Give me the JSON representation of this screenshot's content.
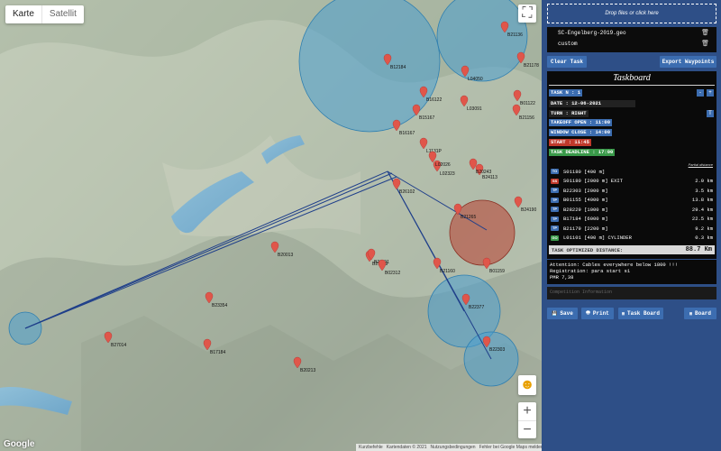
{
  "map": {
    "type_tabs": [
      "Karte",
      "Satellit"
    ],
    "fullscreen_glyph": "⛶",
    "zoom_in": "+",
    "zoom_out": "−",
    "pegman_glyph": "☻",
    "google_logo": "Google",
    "footer": [
      "Kurzbefehle",
      "Kartendaten © 2021",
      "Nutzungsbedingungen",
      "Fehler bei Google Maps melden"
    ],
    "waypoints": [
      "B16122",
      "B12184",
      "B16167",
      "B15167",
      "L1131P",
      "L02323",
      "B21136",
      "B21178",
      "L04050",
      "L03091",
      "B22303",
      "B23354",
      "B24113",
      "B20243",
      "B21265",
      "B22377",
      "B21229",
      "B20013",
      "B17184",
      "B20213",
      "B21191",
      "B02312",
      "B01159",
      "B01122",
      "B21156",
      "B26102",
      "B27014",
      "B24190",
      "L02026",
      "B21160"
    ],
    "colors": {
      "cylinder_blue": "#4a9fd0",
      "cylinder_red": "#b94a3a",
      "route": "#1f3f8a",
      "marker": "#e0564a"
    }
  },
  "panel": {
    "drop_text": "Drop files or click here",
    "files": [
      {
        "name": "SC-Engelberg-2019.geo",
        "delete_icon": "🗑"
      },
      {
        "name": "custom",
        "delete_icon": "🗑"
      }
    ],
    "clear_task": "Clear Task",
    "export_waypoints": "Export Waypoints",
    "taskboard": {
      "title": "Taskboard",
      "task_n": "TASK N : 1",
      "date": "DATE : 12-06-2021",
      "turn": "TURN : RIGHT",
      "takeoff": "TAKEOFF OPEN : 11:00",
      "window_close": "WINDOW CLOSE : 14:00",
      "start": "START : 11:45",
      "deadline": "TASK DEADLINE : 17:00",
      "partial_label": "Partial distance",
      "btn_minus": "-",
      "btn_plus": "+",
      "btn_t": "T",
      "turnpoints": [
        {
          "type": "TO",
          "color": "#3c6db0",
          "name": "S01180 [400 m]",
          "dist": ""
        },
        {
          "type": "SS",
          "color": "#c0392b",
          "name": "S01180 [2000 m] EXIT",
          "dist": "2.0 km"
        },
        {
          "type": "TP",
          "color": "#3c6db0",
          "name": "B22303 [2000 m]",
          "dist": "3.5 km"
        },
        {
          "type": "TP",
          "color": "#3c6db0",
          "name": "B01155 [4000 m]",
          "dist": "13.8 km"
        },
        {
          "type": "TP",
          "color": "#3c6db0",
          "name": "B28229 [1000 m]",
          "dist": "29.4 km"
        },
        {
          "type": "TP",
          "color": "#3c6db0",
          "name": "B17184 [6000 m]",
          "dist": "22.5 km"
        },
        {
          "type": "TP",
          "color": "#3c6db0",
          "name": "B21179 [2200 m]",
          "dist": "9.2 km"
        },
        {
          "type": "GO",
          "color": "#3a9a4a",
          "name": "L01101 [400 m] CYLINDER",
          "dist": "0.3 km"
        }
      ],
      "optimized_label": "TASK OPTIMIZED DISTANCE:",
      "optimized_value": "88.7 Km"
    },
    "notes": [
      "Attention: Cables everywhere below 1800 !!!",
      "Registration: para start s1",
      "PMR 7,38"
    ],
    "comp_placeholder": "Competition Information",
    "buttons": [
      "Save",
      "Print",
      "Task Board",
      "Board"
    ],
    "button_icons": [
      "💾",
      "🖶",
      "▦",
      "▦"
    ]
  }
}
